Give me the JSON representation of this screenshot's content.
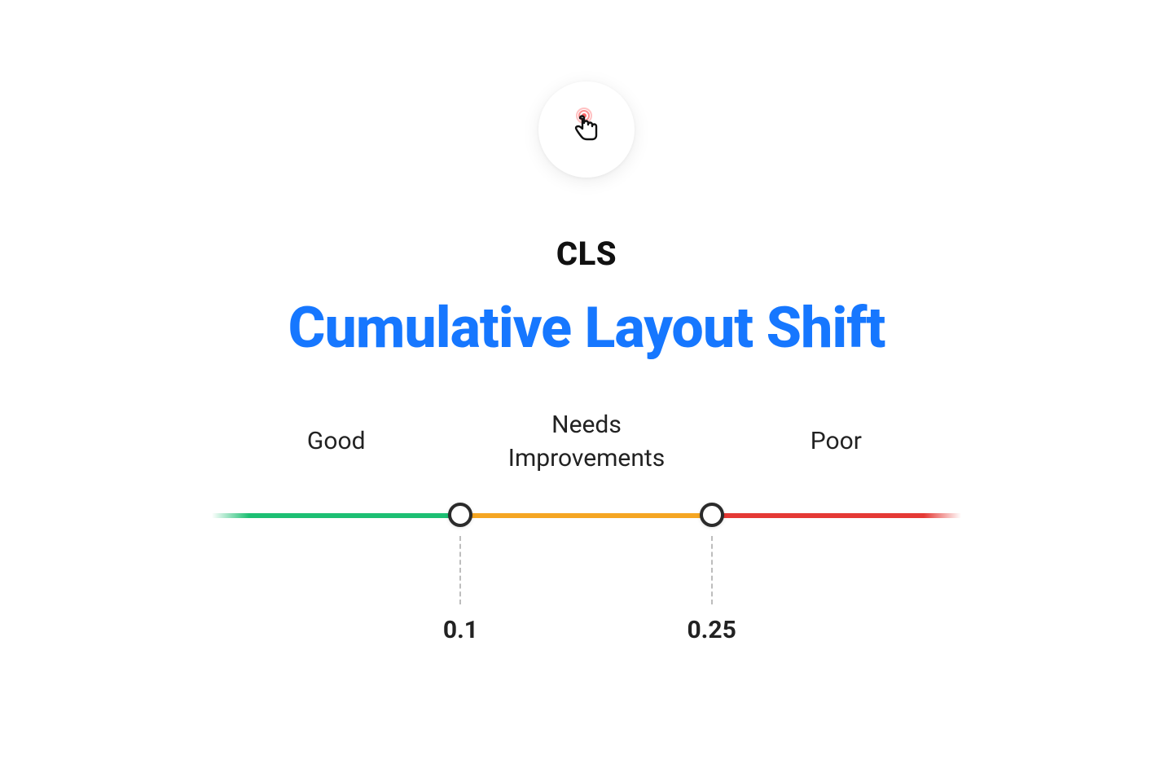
{
  "icon": {
    "name": "touch-tap-icon"
  },
  "abbr": "CLS",
  "title": "Cumulative Layout Shift",
  "colors": {
    "good": "#1dbf73",
    "mid": "#f5a623",
    "poor": "#e53935",
    "title": "#1677ff"
  },
  "scale": {
    "labels": {
      "good": "Good",
      "mid": "Needs\nImprovements",
      "poor": "Poor"
    },
    "thresholds": {
      "t1": "0.1",
      "t2": "0.25"
    }
  },
  "chart_data": {
    "type": "scale",
    "metric": "Cumulative Layout Shift",
    "segments": [
      {
        "name": "Good",
        "range": [
          0,
          0.1
        ],
        "color": "#1dbf73"
      },
      {
        "name": "Needs Improvements",
        "range": [
          0.1,
          0.25
        ],
        "color": "#f5a623"
      },
      {
        "name": "Poor",
        "range": [
          0.25,
          null
        ],
        "color": "#e53935"
      }
    ],
    "thresholds": [
      0.1,
      0.25
    ]
  }
}
